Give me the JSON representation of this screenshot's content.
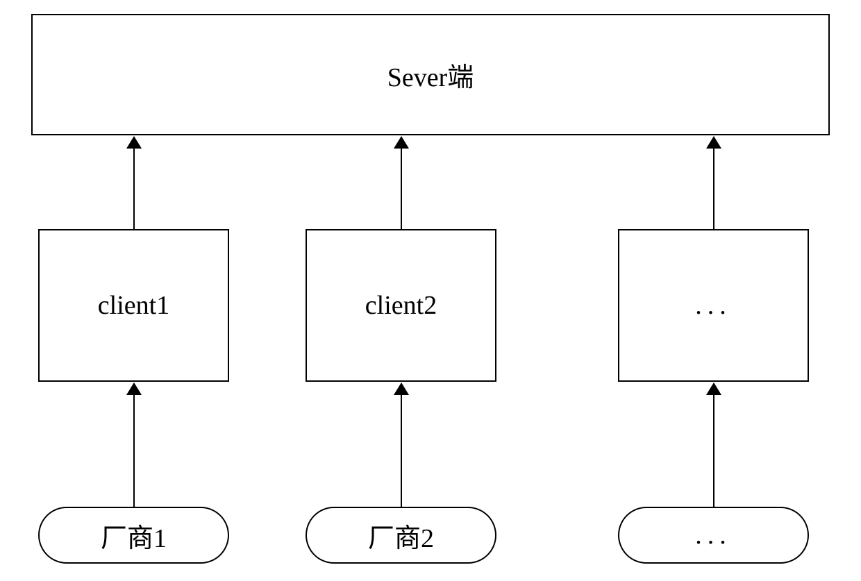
{
  "server": {
    "label": "Sever端"
  },
  "clients": [
    {
      "label": "client1"
    },
    {
      "label": "client2"
    },
    {
      "label": "..."
    }
  ],
  "vendors": [
    {
      "label": "厂商1"
    },
    {
      "label": "厂商2"
    },
    {
      "label": "..."
    }
  ]
}
